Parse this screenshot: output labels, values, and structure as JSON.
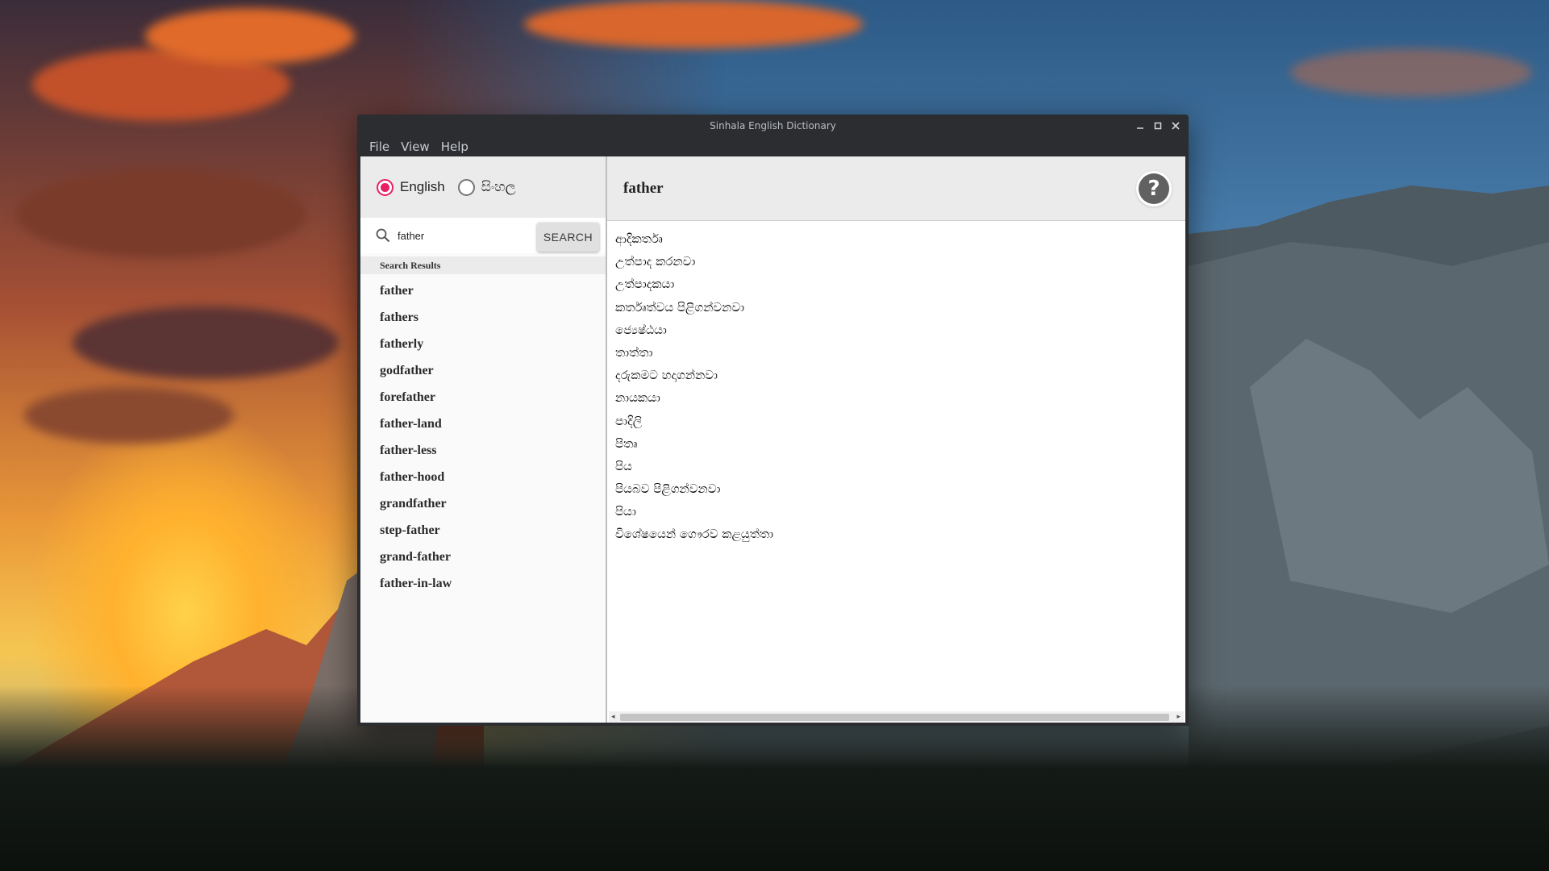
{
  "window": {
    "title": "Sinhala English Dictionary"
  },
  "menu": [
    "File",
    "View",
    "Help"
  ],
  "language": {
    "options": [
      "English",
      "සිංහල"
    ],
    "selected": "English"
  },
  "search": {
    "query": "father",
    "button_label": "SEARCH"
  },
  "results": {
    "header": "Search Results",
    "items": [
      "father",
      "fathers",
      "fatherly",
      "godfather",
      "forefather",
      "father-land",
      "father-less",
      "father-hood",
      "grandfather",
      "step-father",
      "grand-father",
      "father-in-law"
    ]
  },
  "definition": {
    "word": "father",
    "help_label": "?",
    "meanings": [
      "ආදිකර්තෘ",
      "උත්පාද කරනවා",
      "උත්පාදකයා",
      "කර්තෘත්වය පිළිගන්වනවා",
      "ජ්‍යෙෂ්ඨයා",
      "තාත්තා",
      "දරුකමට හදාගන්නවා",
      "නායකයා",
      "පාදිලි",
      "පිතෘ",
      "පිය",
      "පියබව පිළිගන්වනවා",
      "පියා",
      "විශේෂයෙන් ගෞරව කළයුත්තා"
    ]
  },
  "colors": {
    "accent": "#e91e63",
    "titlebar": "#2b2d31"
  }
}
